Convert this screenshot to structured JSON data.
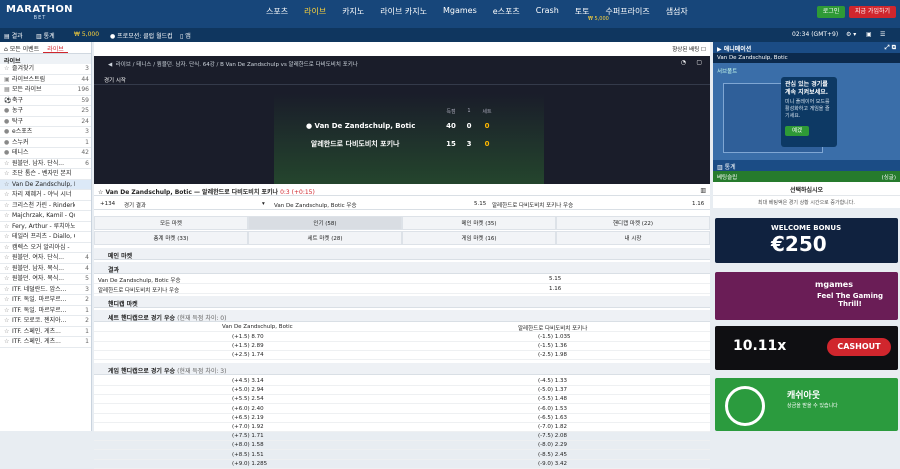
{
  "header": {
    "logo_main": "MARATHON",
    "logo_sub": "BET",
    "nav": [
      "스포츠",
      "라이브",
      "카지노",
      "라이브 카지노",
      "Mgames",
      "e스포츠",
      "Crash",
      "토토",
      "수퍼프라이즈",
      "샘섬자"
    ],
    "nav_active_index": 1,
    "superprize_amount": "₩ 5,000",
    "login": "로그인",
    "join": "지금 가입하기"
  },
  "subheader": {
    "results": "결과",
    "stats": "통계",
    "balance": "₩ 5,000",
    "promo": "프로모션: 클럽 월드컵",
    "app": "앱",
    "time": "02:34 (GMT+9)"
  },
  "left": {
    "tab_all": "모든 이벤트",
    "tab_live": "라이브",
    "section": "라이브",
    "items": [
      {
        "icon": "☆",
        "label": "즐겨찾기",
        "count": "3"
      },
      {
        "icon": "▣",
        "label": "라이브스트림",
        "count": "44"
      },
      {
        "icon": "▦",
        "label": "모든 라이브",
        "count": "196"
      },
      {
        "icon": "⚽",
        "label": "축구",
        "count": "59"
      },
      {
        "icon": "●",
        "label": "농구",
        "count": "25"
      },
      {
        "icon": "●",
        "label": "탁구",
        "count": "24"
      },
      {
        "icon": "●",
        "label": "e스포츠",
        "count": "3"
      },
      {
        "icon": "●",
        "label": "스누커",
        "count": "1"
      },
      {
        "icon": "●",
        "label": "테니스",
        "count": "42"
      },
      {
        "icon": "☆",
        "label": "원블던. 남자. 단식...",
        "count": "6"
      },
      {
        "icon": "☆",
        "label": "조단 톰슨 - 벤자민 본지",
        "count": ""
      },
      {
        "icon": "☆",
        "label": "Van De Zandschulp, Bo...",
        "count": ""
      },
      {
        "icon": "☆",
        "label": "자리 제혜거 - 야닉 시너",
        "count": ""
      },
      {
        "icon": "☆",
        "label": "크리스천 가린 - Rinderk...",
        "count": ""
      },
      {
        "icon": "☆",
        "label": "Majchrzak, Kamil - Quin...",
        "count": ""
      },
      {
        "icon": "☆",
        "label": "Fery, Arthur - 루치아노...",
        "count": ""
      },
      {
        "icon": "☆",
        "label": "테일러 프리츠 - Diallo, G...",
        "count": ""
      },
      {
        "icon": "☆",
        "label": "캠렉스 오거 알리아심 -",
        "count": ""
      },
      {
        "icon": "☆",
        "label": "원블던. 여자. 단식...",
        "count": "4"
      },
      {
        "icon": "☆",
        "label": "원블던. 남자. 복식...",
        "count": "4"
      },
      {
        "icon": "☆",
        "label": "원블던. 여자. 복식...",
        "count": "5"
      },
      {
        "icon": "☆",
        "label": "ITF. 네덜란드. 암스...",
        "count": "3"
      },
      {
        "icon": "☆",
        "label": "ITF. 독일. 마르부르...",
        "count": "2"
      },
      {
        "icon": "☆",
        "label": "ITF. 독일. 마르부르...",
        "count": "1"
      },
      {
        "icon": "☆",
        "label": "ITF. 모로코. 젠지아...",
        "count": "2"
      },
      {
        "icon": "☆",
        "label": "ITF. 스페인. 게츠...",
        "count": "1"
      },
      {
        "icon": "☆",
        "label": "ITF. 스페인. 게츠...",
        "count": "1"
      }
    ]
  },
  "main": {
    "boosted": "향상된 배팅",
    "breadcrumb": "라이브 / 테니스 / 윔블던. 남자. 단식. 64강 / B Van De Zandschulp vs 알레한드로 다비도비치 포키나",
    "event_tab": "경기 시작",
    "score_heads": [
      "득점",
      "1",
      "세트"
    ],
    "players": [
      {
        "name": "Van De Zandschulp, Botic",
        "p": "40",
        "s1": "0",
        "sets": "0"
      },
      {
        "name": "알레한드로 다비도비치 포키나",
        "p": "15",
        "s1": "3",
        "sets": "0"
      }
    ],
    "title": "Van De Zandschulp, Botic — 알레한드로 다비도비치 포키나",
    "live_score": "0:3 (+0:15)",
    "first_row": {
      "more": "+134",
      "market": "경기 결과",
      "o1_label": "Van De Zandschulp, Botic 우승",
      "o1": "5.15",
      "o2_label": "알레한드로 다비도비치 포키나 우승",
      "o2": "1.16"
    },
    "market_tabs": [
      "모든 마켓",
      "인기 (58)",
      "메인 마켓 (35)",
      "핸디캡 마켓 (22)",
      "총계 마켓 (33)",
      "세트 마켓 (28)",
      "게임 마켓 (16)",
      "내 시장"
    ],
    "main_market": "메인 마켓",
    "result": "결과",
    "result_rows": [
      {
        "label": "Van De Zandschulp, Botic 우승",
        "v": "5.15"
      },
      {
        "label": "알레한드로 다비도비치 포키나 우승",
        "v": "1.16"
      }
    ],
    "handicap": "핸디캡 마켓",
    "set_hc": "세트 핸디캡으로 경기 우승",
    "set_hc_sub": "(현재 득점 차이: 0)",
    "col1": "Van De Zandschulp, Botic",
    "col2": "알레한드로 다비도비치 포키나",
    "set_rows": [
      [
        "(+1.5) 8.70",
        "(-1.5) 1.035"
      ],
      [
        "(+1.5) 2.89",
        "(-1.5) 1.36"
      ],
      [
        "(+2.5) 1.74",
        "(-2.5) 1.98"
      ]
    ],
    "game_hc": "게임 핸디캡으로 경기 우승",
    "game_hc_sub": "(현재 득점 차이: 3)",
    "game_rows": [
      [
        "(+4.5) 3.14",
        "(-4.5) 1.33"
      ],
      [
        "(+5.0) 2.94",
        "(-5.0) 1.37"
      ],
      [
        "(+5.5) 2.54",
        "(-5.5) 1.48"
      ],
      [
        "(+6.0) 2.40",
        "(-6.0) 1.53"
      ],
      [
        "(+6.5) 2.19",
        "(-6.5) 1.63"
      ],
      [
        "(+7.0) 1.92",
        "(-7.0) 1.82"
      ],
      [
        "(+7.5) 1.71",
        "(-7.5) 2.08"
      ],
      [
        "(+8.0) 1.58",
        "(-8.0) 2.29"
      ],
      [
        "(+8.5) 1.51",
        "(-8.5) 2.45"
      ],
      [
        "(+9.0) 1.285",
        "(-9.0) 3.42"
      ]
    ]
  },
  "right": {
    "anim": "애니메이션",
    "team": "Van De Zandschulp, Botic",
    "court_label": "서브폴트",
    "tip_title": "관심 있는 경기를 계속 지켜보세요.",
    "tip_body": "미니 플레이어 모드를 활성화하고 게임을 즐기세요.",
    "tip_ok": "예겠",
    "stats": "통계",
    "slip": "베팅슬립",
    "slip_mode": "(싱글)",
    "select": "선택하십시오",
    "note": "최대 베팅액은 경기 상황 시간으로 증가합니다.",
    "b1a": "WELCOME BONUS",
    "b1b": "€250",
    "b2a": "mgames",
    "b2b": "Feel The Gaming Thrill!",
    "b3a": "10.11x",
    "b3b": "CASHOUT",
    "b4a": "캐쉬아웃",
    "b4b": "상금을 받을 수 있습니다"
  }
}
